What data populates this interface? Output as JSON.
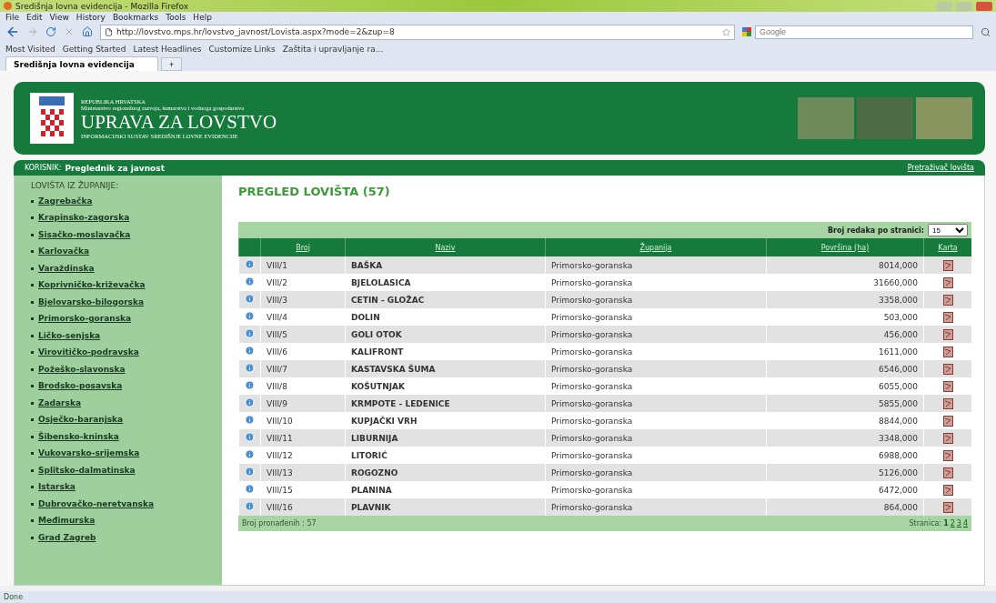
{
  "window": {
    "title": "Središnja lovna evidencija - Mozilla Firefox"
  },
  "menu": [
    "File",
    "Edit",
    "View",
    "History",
    "Bookmarks",
    "Tools",
    "Help"
  ],
  "toolbar": {
    "url": "http://lovstvo.mps.hr/lovstvo_javnost/Lovista.aspx?mode=2&zup=8",
    "search_placeholder": "Google"
  },
  "bookmarks": [
    "Most Visited",
    "Getting Started",
    "Latest Headlines",
    "Customize Links",
    "Zaštita i upravljanje ra..."
  ],
  "tabs": [
    {
      "label": "Središnja lovna evidencija",
      "selected": true
    }
  ],
  "new_tab": "+",
  "header": {
    "country": "REPUBLIKA HRVATSKA",
    "ministry": "Ministarstvo regionalnog razvoja, šumarstva i vodnoga gospodarstva",
    "title": "UPRAVA ZA LOVSTVO",
    "subtitle": "INFORMACIJSKI SUSTAV SREDIŠNJE LOVNE EVIDENCIJE"
  },
  "userbar": {
    "label": "KORISNIK:",
    "user": "Preglednik za javnost",
    "link": "Pretraživač lovišta"
  },
  "sidebar": {
    "heading": "LOVIŠTA IZ ŽUPANIJE:",
    "items": [
      "Zagrebačka",
      "Krapinsko-zagorska",
      "Sisačko-moslavačka",
      "Karlovačka",
      "Varaždinska",
      "Koprivničko-križevačka",
      "Bjelovarsko-bilogorska",
      "Primorsko-goranska",
      "Ličko-senjska",
      "Virovitičko-podravska",
      "Požeško-slavonska",
      "Brodsko-posavska",
      "Zadarska",
      "Osječko-baranjska",
      "Šibensko-kninska",
      "Vukovarsko-srijemska",
      "Splitsko-dalmatinska",
      "Istarska",
      "Dubrovačko-neretvanska",
      "Međimurska",
      "Grad Zagreb"
    ]
  },
  "content": {
    "title": "PREGLED LOVIŠTA (57)",
    "rows_per_page_label": "Broj redaka po stranici:",
    "rows_per_page": "15",
    "columns": [
      "Broj",
      "Naziv",
      "Županija",
      "Površina (ha)",
      "Karta"
    ],
    "rows": [
      {
        "number": "VIII/1",
        "name": "BAŠKA",
        "county": "Primorsko-goranska",
        "area": "8014,000"
      },
      {
        "number": "VIII/2",
        "name": "BJELOLASICA",
        "county": "Primorsko-goranska",
        "area": "31660,000"
      },
      {
        "number": "VIII/3",
        "name": "CETIN - GLOŽAC",
        "county": "Primorsko-goranska",
        "area": "3358,000"
      },
      {
        "number": "VIII/4",
        "name": "DOLIN",
        "county": "Primorsko-goranska",
        "area": "503,000"
      },
      {
        "number": "VIII/5",
        "name": "GOLI OTOK",
        "county": "Primorsko-goranska",
        "area": "456,000"
      },
      {
        "number": "VIII/6",
        "name": "KALIFRONT",
        "county": "Primorsko-goranska",
        "area": "1611,000"
      },
      {
        "number": "VIII/7",
        "name": "KASTAVSKA ŠUMA",
        "county": "Primorsko-goranska",
        "area": "6546,000"
      },
      {
        "number": "VIII/8",
        "name": "KOŠUTNJAK",
        "county": "Primorsko-goranska",
        "area": "6055,000"
      },
      {
        "number": "VIII/9",
        "name": "KRMPOTE - LEDENICE",
        "county": "Primorsko-goranska",
        "area": "5855,000"
      },
      {
        "number": "VIII/10",
        "name": "KUPJAČKI VRH",
        "county": "Primorsko-goranska",
        "area": "8844,000"
      },
      {
        "number": "VIII/11",
        "name": "LIBURNIJA",
        "county": "Primorsko-goranska",
        "area": "3348,000"
      },
      {
        "number": "VIII/12",
        "name": "LITORIĆ",
        "county": "Primorsko-goranska",
        "area": "6988,000"
      },
      {
        "number": "VIII/13",
        "name": "ROGOZNO",
        "county": "Primorsko-goranska",
        "area": "5126,000"
      },
      {
        "number": "VIII/15",
        "name": "PLANINA",
        "county": "Primorsko-goranska",
        "area": "6472,000"
      },
      {
        "number": "VIII/16",
        "name": "PLAVNIK",
        "county": "Primorsko-goranska",
        "area": "864,000"
      }
    ],
    "found": "Broj pronađenih : 57",
    "pages_label": "Stranica:",
    "pages": [
      {
        "label": "1",
        "selected": true
      },
      {
        "label": "2",
        "selected": false
      },
      {
        "label": "3",
        "selected": false
      },
      {
        "label": "4",
        "selected": false
      }
    ]
  },
  "status_bar": "Done"
}
